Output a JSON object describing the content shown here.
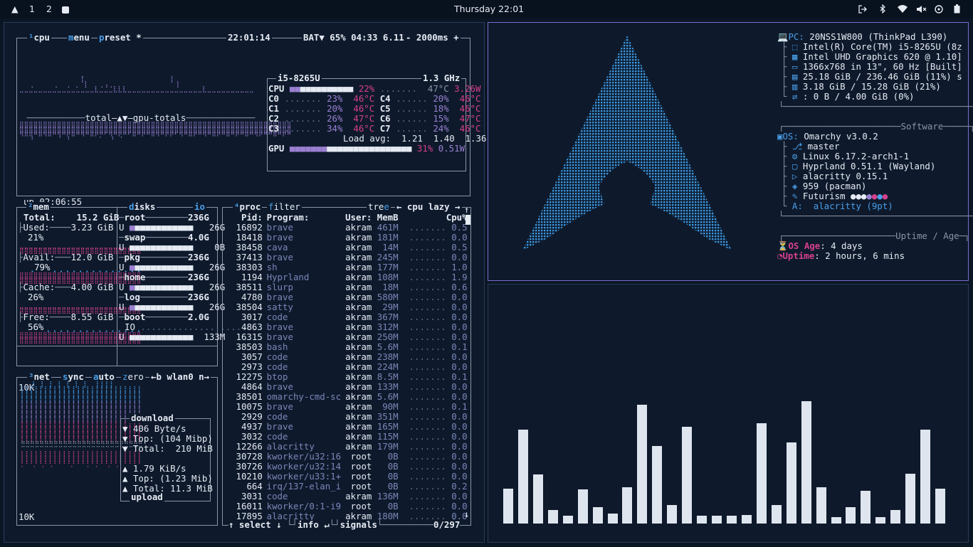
{
  "topbar": {
    "logo": "▲",
    "workspaces": [
      "1",
      "2"
    ],
    "clock": "Thursday 22:01",
    "icons": [
      "logout-icon",
      "bluetooth-icon",
      "wifi-icon",
      "volume-muted-icon",
      "vpn-icon",
      "battery-icon"
    ]
  },
  "btop": {
    "cpu": {
      "label": "cpu",
      "menu": "menu",
      "preset": "preset *",
      "time": "22:01:14",
      "battery": "BAT▼ 65% 04:33 6.11W",
      "interval": "- 2000ms +",
      "graph_label": "total—▲▼—gpu-totals",
      "uptime": "up 02:06:55",
      "cpu_model": "i5-8265U",
      "freq": "1.3 GHz",
      "rows": [
        {
          "name": "CPU",
          "pct": "22%",
          "temp": "47°C",
          "watts": "3.26W"
        },
        {
          "name": "C0",
          "pct": "23%",
          "temp": "46°C"
        },
        {
          "name": "C4",
          "pct": "20%",
          "temp": "46°C"
        },
        {
          "name": "C1",
          "pct": "20%",
          "temp": "46°C"
        },
        {
          "name": "C5",
          "pct": "18%",
          "temp": "46°C"
        },
        {
          "name": "C2",
          "pct": "26%",
          "temp": "47°C"
        },
        {
          "name": "C6",
          "pct": "15%",
          "temp": "47°C"
        },
        {
          "name": "C3",
          "pct": "34%",
          "temp": "46°C"
        },
        {
          "name": "C7",
          "pct": "24%",
          "temp": "46°C"
        }
      ],
      "load": "Load avg:  1.21  1.40  1.36",
      "gpu": {
        "name": "GPU",
        "pct": "31%",
        "watts": "0.51W"
      }
    },
    "mem": {
      "label": "mem",
      "total_label": "Total:",
      "total": "15.2 GiB",
      "used": "Used:",
      "used_v": "3.23 GiB",
      "used_p": "21%",
      "avail": "Avail:",
      "avail_v": "12.0 GiB",
      "avail_p": "79%",
      "cache": "Cache:",
      "cache_v": "4.00 GiB",
      "cache_p": "26%",
      "free": "Free:",
      "free_v": "8.55 GiB",
      "free_p": "56%"
    },
    "disks": {
      "label": "disks",
      "io": "io",
      "items": [
        {
          "name": "root",
          "size": "236G",
          "used": "26G"
        },
        {
          "name": "swap",
          "size": "4.0G",
          "used": "0B"
        },
        {
          "name": "pkg",
          "size": "236G",
          "used": "26G"
        },
        {
          "name": "home",
          "size": "236G",
          "used": "26G"
        },
        {
          "name": "log",
          "size": "236G",
          "used": "26G"
        },
        {
          "name": "boot",
          "size": "2.0G",
          "used": "133M"
        }
      ],
      "io_label": "IO"
    },
    "net": {
      "label": "net",
      "sync": "sync",
      "auto": "auto",
      "zero": "zero",
      "iface": "←b wlan0 n→",
      "top": "10K",
      "bottom": "10K",
      "download": "download",
      "dl_rate": "▼ 406 Byte/s",
      "dl_top": "▼ Top: (104 Mibp)",
      "dl_total": "▼ Total:  210 MiB",
      "ul_rate": "▲ 1.79 KiB/s",
      "ul_top": "▲ Top: (1.23 Mib)",
      "ul_total": "▲ Total: 11.3 MiB",
      "upload": "upload"
    },
    "proc": {
      "label": "proc",
      "filter": "filter",
      "tree": "tree",
      "sort": "← cpu lazy →",
      "headers": [
        "Pid:",
        "Program:",
        "User:",
        "MemB",
        "Cpu%"
      ],
      "rows": [
        [
          "16892",
          "brave",
          "akram",
          "461M",
          "0.5"
        ],
        [
          "18418",
          "brave",
          "akram",
          "181M",
          "0.0"
        ],
        [
          "38458",
          "cava",
          "akram",
          "14M",
          "0.5"
        ],
        [
          "37413",
          "brave",
          "akram",
          "245M",
          "0.0"
        ],
        [
          "38303",
          "sh",
          "akram",
          "177M",
          "1.0"
        ],
        [
          "1194",
          "Hyprland",
          "akram",
          "108M",
          "1.9"
        ],
        [
          "38511",
          "slurp",
          "akram",
          "18M",
          "0.6"
        ],
        [
          "4780",
          "brave",
          "akram",
          "580M",
          "0.0"
        ],
        [
          "38504",
          "satty",
          "akram",
          "29M",
          "0.0"
        ],
        [
          "3017",
          "code",
          "akram",
          "367M",
          "0.0"
        ],
        [
          "4863",
          "brave",
          "akram",
          "312M",
          "0.0"
        ],
        [
          "16315",
          "brave",
          "akram",
          "250M",
          "0.0"
        ],
        [
          "38503",
          "bash",
          "akram",
          "5.6M",
          "0.1"
        ],
        [
          "3057",
          "code",
          "akram",
          "238M",
          "0.0"
        ],
        [
          "2973",
          "code",
          "akram",
          "224M",
          "0.0"
        ],
        [
          "12275",
          "btop",
          "akram",
          "8.5M",
          "0.1"
        ],
        [
          "4864",
          "brave",
          "akram",
          "133M",
          "0.0"
        ],
        [
          "38501",
          "omarchy-cmd-sc",
          "akram",
          "5.6M",
          "0.0"
        ],
        [
          "10075",
          "brave",
          "akram",
          "90M",
          "0.1"
        ],
        [
          "2929",
          "code",
          "akram",
          "351M",
          "0.0"
        ],
        [
          "4937",
          "brave",
          "akram",
          "165M",
          "0.0"
        ],
        [
          "3032",
          "code",
          "akram",
          "115M",
          "0.0"
        ],
        [
          "12266",
          "alacritty",
          "akram",
          "179M",
          "0.0"
        ],
        [
          "30728",
          "kworker/u32:16",
          "root",
          "0B",
          "0.0"
        ],
        [
          "30726",
          "kworker/u32:14",
          "root",
          "0B",
          "0.0"
        ],
        [
          "10210",
          "kworker/u33:1+",
          "root",
          "0B",
          "0.0"
        ],
        [
          "664",
          "irq/137-elan_i",
          "root",
          "0B",
          "0.2"
        ],
        [
          "3031",
          "code",
          "akram",
          "136M",
          "0.0"
        ],
        [
          "16011",
          "kworker/0:1-i9",
          "root",
          "0B",
          "0.0"
        ],
        [
          "17895",
          "alacritty",
          "akram",
          "180M",
          "0.0"
        ]
      ],
      "footer_select": "↑ select ↓",
      "footer_info": "info ↵",
      "footer_signals": "signals",
      "count": "0/297"
    }
  },
  "fastfetch": {
    "pc": [
      "PC:",
      "20NSS1W800 (ThinkPad L390)"
    ],
    "hw": [
      "Intel(R) Core(TM) i5-8265U (8z",
      "Intel UHD Graphics 620 @ 1.10]",
      "1366x768 in 13\", 60 Hz [Built]",
      "25.18 GiB / 236.46 GiB (11%) s",
      "3.18 GiB / 15.28 GiB (21%)",
      ": 0 B / 4.00 GiB (0%)"
    ],
    "software_title": "Software",
    "os": [
      "OS:",
      "Omarchy v3.0.2"
    ],
    "sw": [
      "master",
      "Linux 6.17.2-arch1-1",
      "Hyprland 0.51.1 (Wayland)",
      "alacritty 0.15.1",
      "959 (pacman)",
      "Futurism ",
      "A:  alacritty (9pt)"
    ],
    "uptime_title": "Uptime / Age",
    "os_age": [
      "OS Age",
      "4 days"
    ],
    "uptime": [
      "Uptime",
      "2 hours, 6 mins"
    ]
  },
  "cava": {
    "values": [
      0.28,
      0.75,
      0.39,
      0.11,
      0.06,
      0.27,
      0.13,
      0.08,
      0.29,
      0.95,
      0.62,
      0.15,
      0.77,
      0.06,
      0.06,
      0.06,
      0.07,
      0.8,
      0.15,
      0.65,
      0.98,
      0.29,
      0.05,
      0.13,
      0.26,
      0.05,
      0.11,
      0.4,
      0.75,
      0.28
    ]
  },
  "colors": {
    "accent": "#4a9ee8",
    "pink": "#d6408e",
    "purple": "#9a7fd1"
  }
}
